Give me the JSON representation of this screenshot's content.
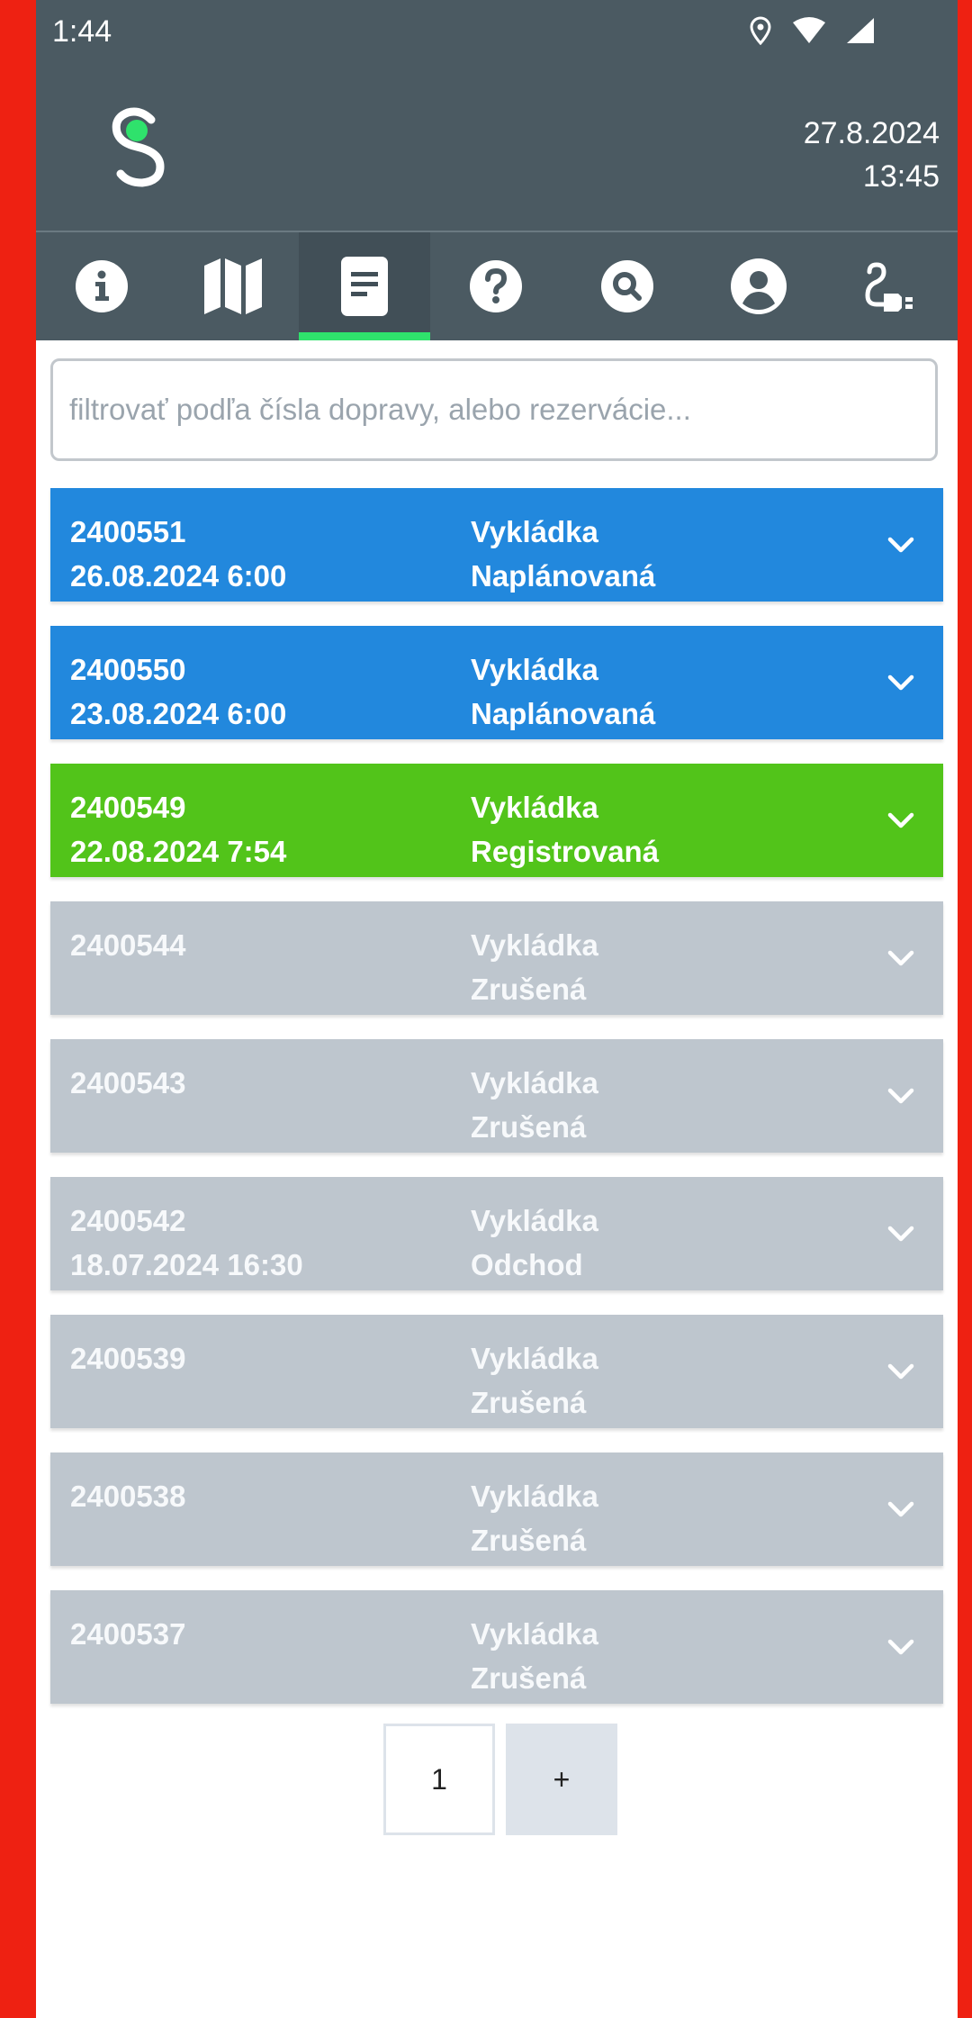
{
  "status_bar": {
    "time": "1:44",
    "icons": [
      "location-icon",
      "wifi-icon",
      "signal-icon"
    ]
  },
  "header": {
    "logo": "app-logo",
    "date": "27.8.2024",
    "time": "13:45"
  },
  "nav": {
    "items": [
      {
        "icon": "info-icon"
      },
      {
        "icon": "map-icon"
      },
      {
        "icon": "document-icon",
        "active": true
      },
      {
        "icon": "help-icon"
      },
      {
        "icon": "search-icon"
      },
      {
        "icon": "user-icon"
      },
      {
        "icon": "logout-plug-icon"
      }
    ]
  },
  "filter": {
    "placeholder": "filtrovať podľa čísla dopravy, alebo rezervácie...",
    "value": ""
  },
  "colors": {
    "header": "#4b5a62",
    "planned": "#2288dd",
    "registered": "#52c41a",
    "inactive": "#bec6ce",
    "accent": "#2fe26c"
  },
  "rows": [
    {
      "id": "2400551",
      "date": "26.08.2024 6:00",
      "type": "Vykládka",
      "status": "Naplánovaná",
      "color": "#2288dd"
    },
    {
      "id": "2400550",
      "date": "23.08.2024 6:00",
      "type": "Vykládka",
      "status": "Naplánovaná",
      "color": "#2288dd"
    },
    {
      "id": "2400549",
      "date": "22.08.2024 7:54",
      "type": "Vykládka",
      "status": "Registrovaná",
      "color": "#52c41a"
    },
    {
      "id": "2400544",
      "date": "",
      "type": "Vykládka",
      "status": "Zrušená",
      "color": "#bec6ce"
    },
    {
      "id": "2400543",
      "date": "",
      "type": "Vykládka",
      "status": "Zrušená",
      "color": "#bec6ce"
    },
    {
      "id": "2400542",
      "date": "18.07.2024 16:30",
      "type": "Vykládka",
      "status": "Odchod",
      "color": "#bec6ce"
    },
    {
      "id": "2400539",
      "date": "",
      "type": "Vykládka",
      "status": "Zrušená",
      "color": "#bec6ce"
    },
    {
      "id": "2400538",
      "date": "",
      "type": "Vykládka",
      "status": "Zrušená",
      "color": "#bec6ce"
    },
    {
      "id": "2400537",
      "date": "",
      "type": "Vykládka",
      "status": "Zrušená",
      "color": "#bec6ce"
    }
  ],
  "pagination": {
    "current": "1",
    "add": "+"
  }
}
